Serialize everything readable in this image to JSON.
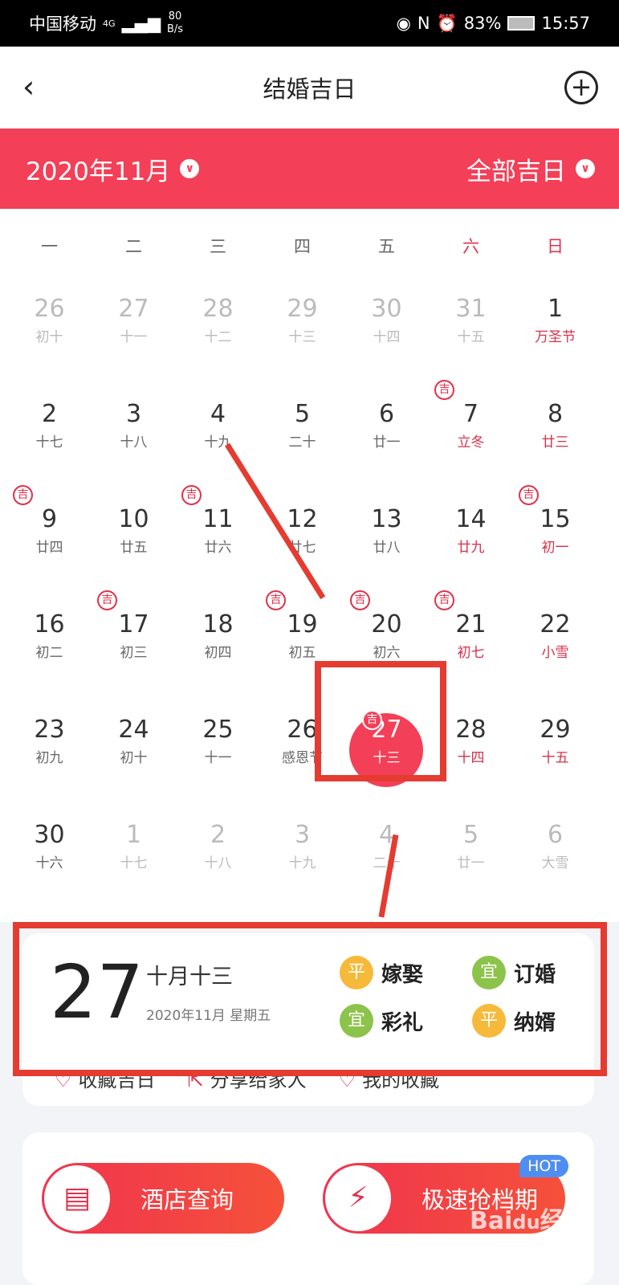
{
  "status": {
    "carrier": "中国移动",
    "network": "4G",
    "speed_value": "80",
    "speed_unit": "B/s",
    "battery": "83%",
    "time": "15:57"
  },
  "nav": {
    "title": "结婚吉日",
    "back_icon": "chevron-left-icon",
    "add_icon": "plus-circle-icon"
  },
  "filter": {
    "month": "2020年11月",
    "type": "全部吉日"
  },
  "weekdays": [
    "一",
    "二",
    "三",
    "四",
    "五",
    "六",
    "日"
  ],
  "days": [
    {
      "n": "26",
      "l": "初十",
      "o": true
    },
    {
      "n": "27",
      "l": "十一",
      "o": true
    },
    {
      "n": "28",
      "l": "十二",
      "o": true
    },
    {
      "n": "29",
      "l": "十三",
      "o": true
    },
    {
      "n": "30",
      "l": "十四",
      "o": true
    },
    {
      "n": "31",
      "l": "十五",
      "o": true
    },
    {
      "n": "1",
      "l": "万圣节",
      "r": true
    },
    {
      "n": "2",
      "l": "十七"
    },
    {
      "n": "3",
      "l": "十八"
    },
    {
      "n": "4",
      "l": "十九"
    },
    {
      "n": "5",
      "l": "二十"
    },
    {
      "n": "6",
      "l": "廿一"
    },
    {
      "n": "7",
      "l": "立冬",
      "r": true,
      "j": true
    },
    {
      "n": "8",
      "l": "廿三",
      "r": true
    },
    {
      "n": "9",
      "l": "廿四",
      "j": true
    },
    {
      "n": "10",
      "l": "廿五"
    },
    {
      "n": "11",
      "l": "廿六",
      "j": true
    },
    {
      "n": "12",
      "l": "廿七"
    },
    {
      "n": "13",
      "l": "廿八"
    },
    {
      "n": "14",
      "l": "廿九",
      "r": true
    },
    {
      "n": "15",
      "l": "初一",
      "r": true,
      "j": true
    },
    {
      "n": "16",
      "l": "初二"
    },
    {
      "n": "17",
      "l": "初三",
      "j": true
    },
    {
      "n": "18",
      "l": "初四"
    },
    {
      "n": "19",
      "l": "初五",
      "j": true
    },
    {
      "n": "20",
      "l": "初六",
      "j": true
    },
    {
      "n": "21",
      "l": "初七",
      "r": true,
      "j": true
    },
    {
      "n": "22",
      "l": "小雪",
      "r": true
    },
    {
      "n": "23",
      "l": "初九"
    },
    {
      "n": "24",
      "l": "初十"
    },
    {
      "n": "25",
      "l": "十一"
    },
    {
      "n": "26",
      "l": "感恩节"
    },
    {
      "n": "27",
      "l": "十三",
      "j": true,
      "s": true
    },
    {
      "n": "28",
      "l": "十四",
      "r": true
    },
    {
      "n": "29",
      "l": "十五",
      "r": true
    },
    {
      "n": "30",
      "l": "十六"
    },
    {
      "n": "1",
      "l": "十七",
      "o": true
    },
    {
      "n": "2",
      "l": "十八",
      "o": true
    },
    {
      "n": "3",
      "l": "十九",
      "o": true
    },
    {
      "n": "4",
      "l": "二十",
      "o": true
    },
    {
      "n": "5",
      "l": "廿一",
      "o": true
    },
    {
      "n": "6",
      "l": "大雪",
      "o": true
    }
  ],
  "ji_label": "吉",
  "detail": {
    "day": "27",
    "lunar": "十月十三",
    "date_line": "2020年11月 星期五",
    "tags": [
      {
        "badge": "平",
        "label": "嫁娶",
        "color": "#f7b93a"
      },
      {
        "badge": "宜",
        "label": "订婚",
        "color": "#8cc34a"
      },
      {
        "badge": "宜",
        "label": "彩礼",
        "color": "#8cc34a"
      },
      {
        "badge": "平",
        "label": "纳婿",
        "color": "#f7b93a"
      }
    ],
    "actions": [
      "收藏吉日",
      "分享给家人",
      "我的收藏"
    ]
  },
  "buttons": {
    "hotel": "酒店查询",
    "book": "极速抢档期",
    "hot": "HOT"
  },
  "watermark": "Bai经验",
  "colors": {
    "brand": "#f33f57",
    "annotation": "#e53b30"
  }
}
